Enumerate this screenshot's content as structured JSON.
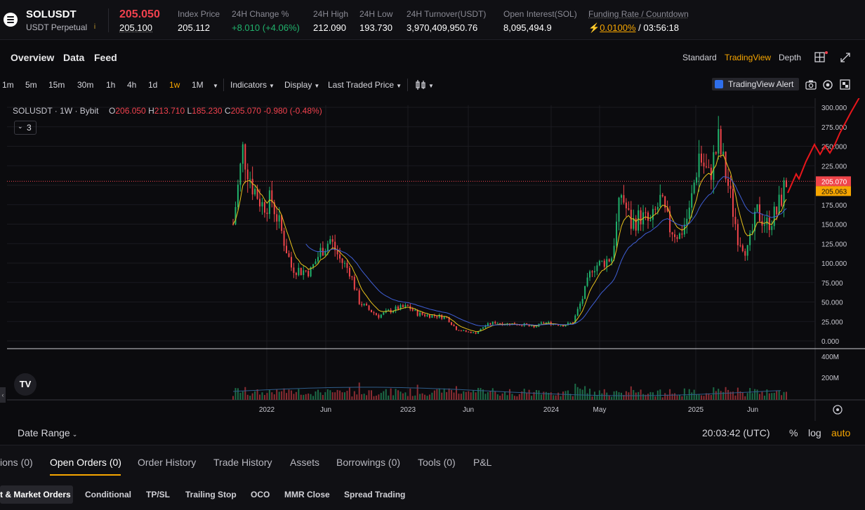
{
  "ticker": {
    "symbol": "SOLUSDT",
    "contract_type": "USDT Perpetual",
    "info_icon": "info-icon",
    "last_price": "205.050",
    "mark_price": "205.100",
    "stats": [
      {
        "label": "Index Price",
        "value": "205.112"
      },
      {
        "label": "24H Change %",
        "value": "+8.010 (+4.06%)"
      },
      {
        "label": "24H High",
        "value": "212.090"
      },
      {
        "label": "24H Low",
        "value": "193.730"
      },
      {
        "label": "24H Turnover(USDT)",
        "value": "3,970,409,950.76"
      },
      {
        "label": "Open Interest(SOL)",
        "value": "8,095,494.9"
      }
    ],
    "funding_label": "Funding Rate / Countdown",
    "funding_rate": "0.0100%",
    "funding_countdown": " / 03:56:18"
  },
  "panel_tabs": [
    "Overview",
    "Data",
    "Feed"
  ],
  "view_tabs": [
    "Standard",
    "TradingView",
    "Depth"
  ],
  "view_active": "TradingView",
  "toolbar": {
    "timeframes": [
      "1m",
      "5m",
      "15m",
      "30m",
      "1h",
      "4h",
      "1d",
      "1w",
      "1M"
    ],
    "active_timeframe": "1w",
    "indicators": "Indicators",
    "display": "Display",
    "price_type": "Last Traded Price",
    "tv_alert": "TradingView Alert"
  },
  "legend": {
    "symbol_line": "SOLUSDT · 1W · Bybit",
    "open": "206.050",
    "high": "213.710",
    "low": "185.230",
    "close": "205.070",
    "change": "-0.980 (-0.48%)",
    "indicator_count": "3"
  },
  "chart_bar": {
    "date_range": "Date Range",
    "clock": "20:03:42 (UTC)",
    "percent": "%",
    "log": "log",
    "auto": "auto"
  },
  "orders": {
    "tabs": [
      "ions (0)",
      "Open Orders (0)",
      "Order History",
      "Trade History",
      "Assets",
      "Borrowings (0)",
      "Tools (0)",
      "P&L"
    ],
    "active_tab": "Open Orders (0)",
    "subtabs": [
      "t & Market Orders",
      "Conditional",
      "TP/SL",
      "Trailing Stop",
      "OCO",
      "MMR Close",
      "Spread Trading"
    ]
  },
  "chart_data": {
    "type": "candlestick",
    "title": "",
    "symbol": "SOLUSDT",
    "interval": "1W",
    "exchange": "Bybit",
    "y_ticks": [
      0,
      25,
      50,
      75,
      100,
      125,
      150,
      175,
      200,
      225,
      250,
      275,
      300
    ],
    "ylim": [
      0,
      310
    ],
    "volume_ticks": [
      "200M",
      "400M"
    ],
    "x_tick_labels": [
      "2022",
      "Jun",
      "2023",
      "Jun",
      "2024",
      "May",
      "2025",
      "Jun"
    ],
    "last_price_label": "205.070",
    "mark_price_label": "205.063",
    "price_series": [
      [
        "2021-11",
        150
      ],
      [
        "2021-11",
        245
      ],
      [
        "2021-12",
        200
      ],
      [
        "2021-12",
        175
      ],
      [
        "2022-01",
        180
      ],
      [
        "2022-01",
        140
      ],
      [
        "2022-02",
        95
      ],
      [
        "2022-02",
        90
      ],
      [
        "2022-03",
        90
      ],
      [
        "2022-03",
        115
      ],
      [
        "2022-04",
        130
      ],
      [
        "2022-04",
        105
      ],
      [
        "2022-05",
        90
      ],
      [
        "2022-05",
        50
      ],
      [
        "2022-06",
        40
      ],
      [
        "2022-06",
        32
      ],
      [
        "2022-07",
        38
      ],
      [
        "2022-07",
        42
      ],
      [
        "2022-08",
        44
      ],
      [
        "2022-08",
        35
      ],
      [
        "2022-09",
        33
      ],
      [
        "2022-10",
        32
      ],
      [
        "2022-11",
        30
      ],
      [
        "2022-11",
        15
      ],
      [
        "2022-12",
        12
      ],
      [
        "2022-12",
        10
      ],
      [
        "2023-01",
        20
      ],
      [
        "2023-02",
        24
      ],
      [
        "2023-03",
        22
      ],
      [
        "2023-04",
        22
      ],
      [
        "2023-05",
        21
      ],
      [
        "2023-06",
        17
      ],
      [
        "2023-07",
        24
      ],
      [
        "2023-08",
        22
      ],
      [
        "2023-09",
        20
      ],
      [
        "2023-10",
        24
      ],
      [
        "2023-11",
        55
      ],
      [
        "2023-12",
        95
      ],
      [
        "2024-01",
        100
      ],
      [
        "2024-02",
        108
      ],
      [
        "2024-03",
        190
      ],
      [
        "2024-04",
        150
      ],
      [
        "2024-05",
        160
      ],
      [
        "2024-06",
        150
      ],
      [
        "2024-07",
        180
      ],
      [
        "2024-08",
        145
      ],
      [
        "2024-09",
        135
      ],
      [
        "2024-10",
        165
      ],
      [
        "2024-11",
        240
      ],
      [
        "2024-12",
        210
      ],
      [
        "2025-01",
        255
      ],
      [
        "2025-02",
        200
      ],
      [
        "2025-03",
        135
      ],
      [
        "2025-04",
        115
      ],
      [
        "2025-05",
        165
      ],
      [
        "2025-06",
        150
      ],
      [
        "2025-07",
        165
      ],
      [
        "2025-07",
        205
      ]
    ],
    "drawing": "red hand-drawn projection line beyond last candle"
  }
}
